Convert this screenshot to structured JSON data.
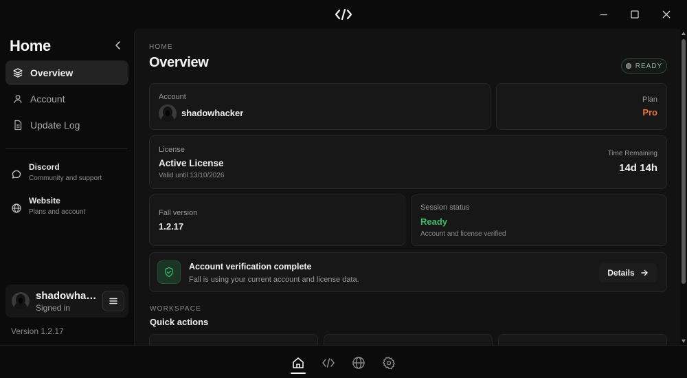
{
  "titlebar": {
    "logo_icon": "code-brackets-icon",
    "controls": [
      "minimize-icon",
      "maximize-icon",
      "close-icon"
    ]
  },
  "sidebar": {
    "title": "Home",
    "nav": [
      {
        "label": "Overview",
        "icon": "layers-icon",
        "active": true
      },
      {
        "label": "Account",
        "icon": "user-icon",
        "active": false
      },
      {
        "label": "Update Log",
        "icon": "document-icon",
        "active": false
      }
    ],
    "links": [
      {
        "title": "Discord",
        "subtitle": "Community and support",
        "icon": "chat-bubble-icon"
      },
      {
        "title": "Website",
        "subtitle": "Plans and account",
        "icon": "globe-icon"
      }
    ],
    "user": {
      "name": "shadowhacker",
      "status": "Signed in"
    },
    "version": "Version 1.2.17"
  },
  "main": {
    "breadcrumb": "HOME",
    "title": "Overview",
    "status_badge": "READY",
    "account": {
      "label": "Account",
      "username": "shadowhacker"
    },
    "plan": {
      "label": "Plan",
      "value": "Pro"
    },
    "license": {
      "label": "License",
      "value": "Active License",
      "valid_until": "Valid until 13/10/2026",
      "time_label": "Time Remaining",
      "time_value": "14d 14h"
    },
    "version_card": {
      "label": "Fall version",
      "value": "1.2.17"
    },
    "session": {
      "label": "Session status",
      "value": "Ready",
      "detail": "Account and license verified"
    },
    "verification": {
      "title": "Account verification complete",
      "message": "Fall is using your current account and license data.",
      "button": "Details"
    },
    "workspace": {
      "label": "WORKSPACE",
      "title": "Quick actions"
    }
  },
  "bottom_nav": [
    {
      "icon": "home-icon",
      "active": true
    },
    {
      "icon": "code-icon",
      "active": false
    },
    {
      "icon": "globe-icon",
      "active": false
    },
    {
      "icon": "settings-gear-icon",
      "active": false
    }
  ],
  "colors": {
    "accent_orange": "#e8753a",
    "status_green": "#3fbf6a",
    "background": "#0b0b0b",
    "panel": "#121212",
    "card": "#171717"
  }
}
